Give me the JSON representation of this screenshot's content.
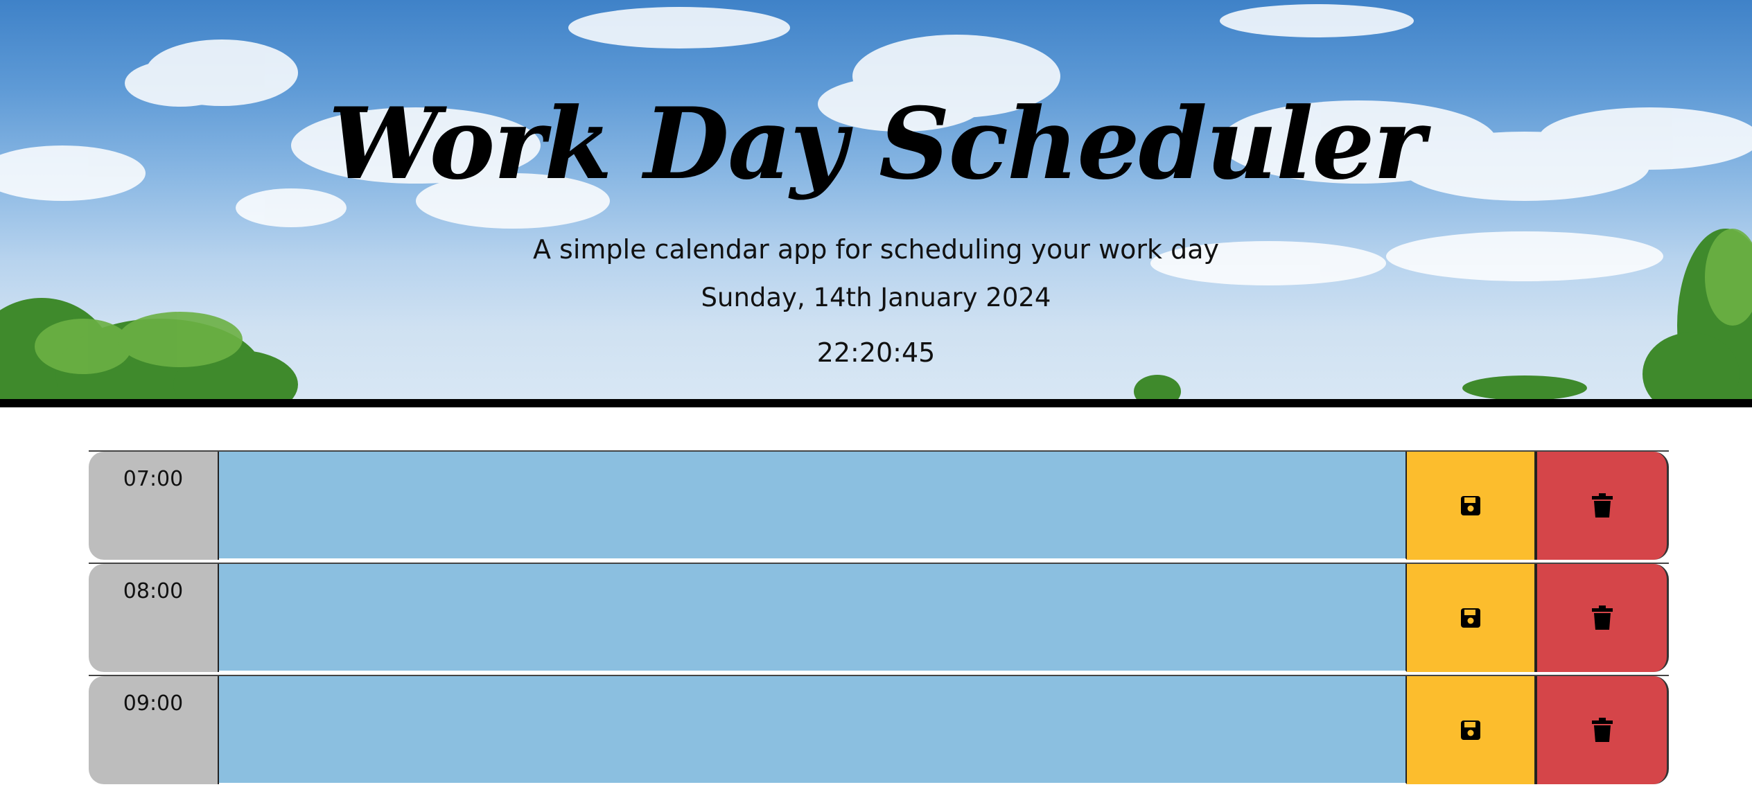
{
  "header": {
    "title": "Work Day Scheduler",
    "subtitle": "A simple calendar app for scheduling your work day",
    "date": "Sunday, 14th January 2024",
    "time": "22:20:45"
  },
  "schedule": {
    "rows": [
      {
        "hour": "07:00",
        "description": ""
      },
      {
        "hour": "08:00",
        "description": ""
      },
      {
        "hour": "09:00",
        "description": ""
      }
    ]
  },
  "icons": {
    "save": "floppy-disk-icon",
    "delete": "trash-icon"
  },
  "colors": {
    "hour_block": "#bdbdbd",
    "future_row": "#8bbfe0",
    "save_button": "#fcbd2d",
    "delete_button": "#d54549",
    "header_border": "#000000"
  }
}
